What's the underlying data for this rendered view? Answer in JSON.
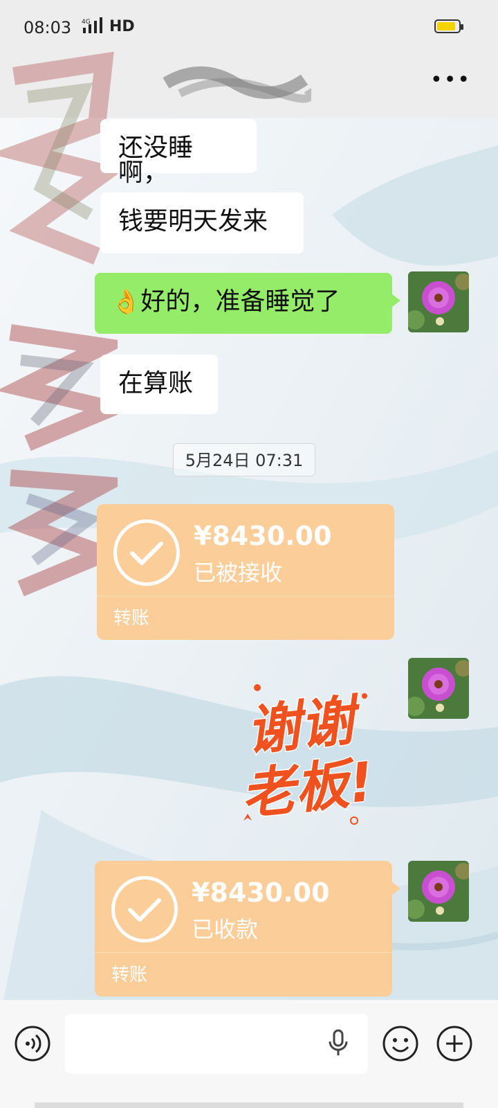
{
  "status_bar": {
    "time": "08:03",
    "network": "4G",
    "hd": "HD"
  },
  "messages": [
    {
      "side": "left",
      "text": "还没睡啊，"
    },
    {
      "side": "left",
      "text": "钱要明天发来"
    },
    {
      "side": "right",
      "emoji": "👌",
      "text": "好的，准备睡觉了"
    },
    {
      "side": "left",
      "text": "在算账"
    }
  ],
  "timestamp": "5月24日 07:31",
  "transfers": [
    {
      "side": "left",
      "amount": "¥8430.00",
      "status": "已被接收",
      "label": "转账"
    },
    {
      "side": "right",
      "amount": "¥8430.00",
      "status": "已收款",
      "label": "转账"
    }
  ],
  "sticker": {
    "line1": "谢谢",
    "line2": "老板!"
  },
  "colors": {
    "self_bubble": "#95ec69",
    "transfer_card": "#fbcd99",
    "sticker_text": "#f0521f"
  },
  "icons": {
    "voice": "voice-icon",
    "mic": "microphone-icon",
    "emoji": "emoji-icon",
    "more": "plus-icon",
    "menu": "more-options-icon"
  }
}
